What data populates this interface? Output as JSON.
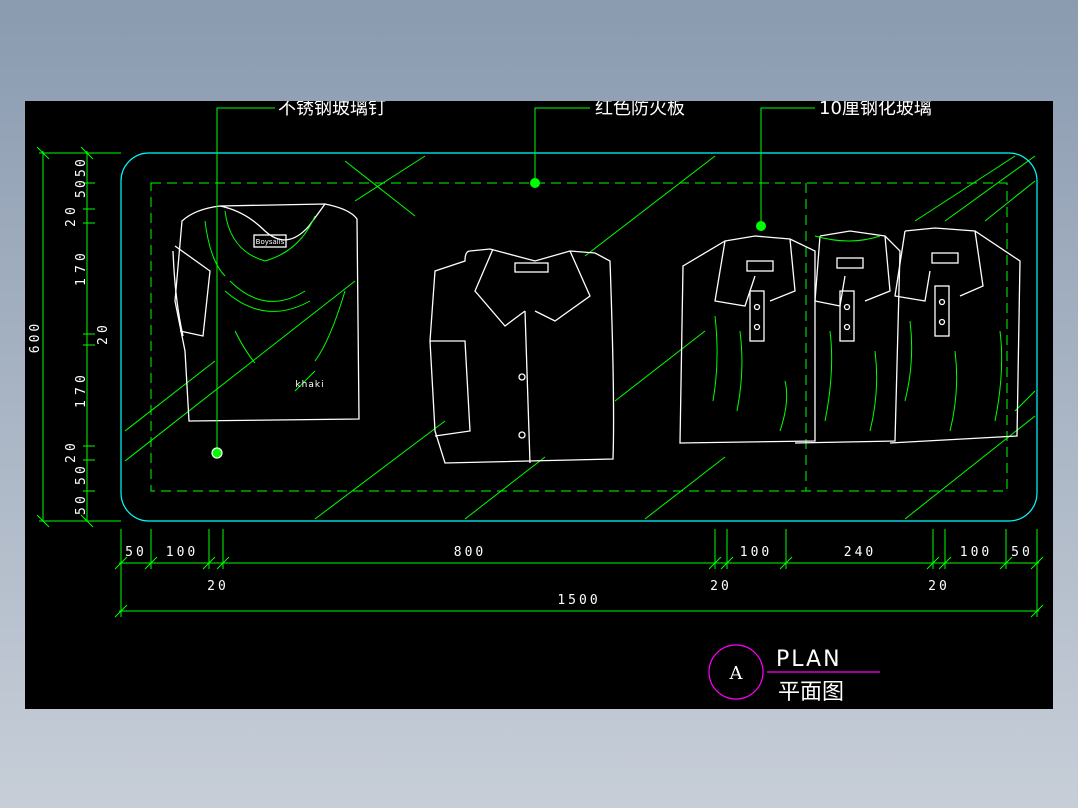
{
  "labels": {
    "glass_nail": "不锈钢玻璃钉",
    "fireproof_board": "红色防火板",
    "tempered_glass": "10厘钢化玻璃"
  },
  "shirts": {
    "brand_tag": "Boysalls",
    "print_text": "khaki"
  },
  "dims": {
    "left": [
      "5",
      "0",
      "5",
      "0",
      "2",
      "0",
      "1",
      "7",
      "0",
      "2",
      "0",
      "1",
      "7",
      "0",
      "2",
      "0",
      "5",
      "0",
      "5",
      "0"
    ],
    "left_total": "600",
    "bottom": [
      "50",
      "100",
      "800",
      "100",
      "240",
      "100",
      "50"
    ],
    "bottom_gaps": [
      "20",
      "20",
      "20"
    ],
    "total": "1500"
  },
  "title": {
    "marker": "A",
    "en": "PLAN",
    "cn": "平面图"
  },
  "colors": {
    "background": "#000000",
    "outline": "#00ffff",
    "dashed": "#00ff00",
    "shirt": "#ffffff",
    "detail": "#00ff00",
    "marker": "#ff00ff"
  }
}
